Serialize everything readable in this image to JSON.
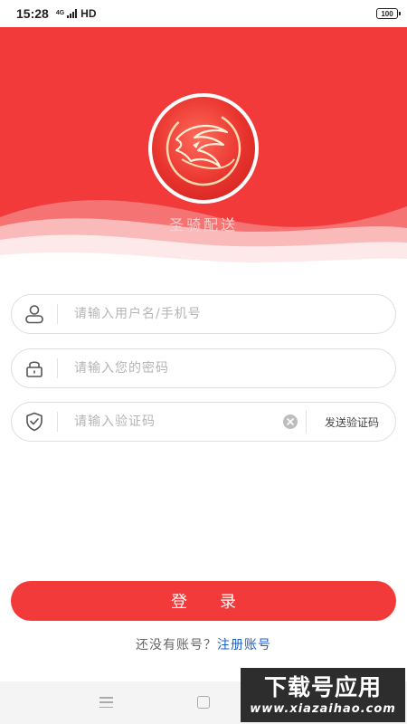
{
  "status_bar": {
    "time": "15:28",
    "network_top": "4G",
    "network_bottom": "ul",
    "hd": "HD",
    "battery": "100"
  },
  "header": {
    "app_name": "圣骑配送",
    "logo_icon": "knight-horse-logo",
    "background_color": "#f23a3a"
  },
  "form": {
    "username": {
      "placeholder": "请输入用户名/手机号",
      "value": "",
      "icon": "user-icon"
    },
    "password": {
      "placeholder": "请输入您的密码",
      "value": "",
      "icon": "lock-icon"
    },
    "code": {
      "placeholder": "请输入验证码",
      "value": "",
      "icon": "shield-check-icon",
      "clear_icon": "clear-icon",
      "send_label": "发送验证码"
    }
  },
  "login": {
    "label": "登录"
  },
  "register": {
    "prompt": "还没有账号？",
    "link_label": "注册账号",
    "link_color": "#1d5fc7"
  },
  "watermark": {
    "title": "下载号应用",
    "domain": "www.xiazaihao.com"
  }
}
